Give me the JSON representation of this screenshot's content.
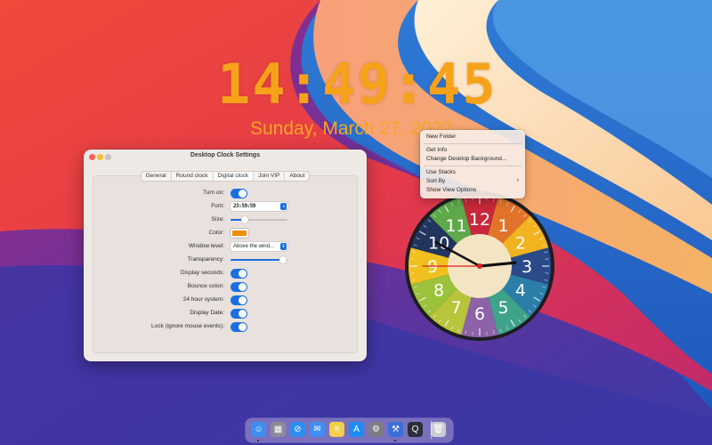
{
  "desktop_clock": {
    "time": "14:49:45",
    "date": "Sunday, March 27, 2022",
    "color": "#f6a21a"
  },
  "settings_window": {
    "title": "Desktop Clock Settings",
    "tabs": [
      {
        "label": "General",
        "active": false
      },
      {
        "label": "Round clock",
        "active": false
      },
      {
        "label": "Digital clock",
        "active": true
      },
      {
        "label": "Join VIP",
        "active": false
      },
      {
        "label": "About",
        "active": false
      }
    ],
    "rows": {
      "turn_on": {
        "label": "Turn on:",
        "value": true
      },
      "font": {
        "label": "Font:",
        "value": "23:59:59"
      },
      "size": {
        "label": "Size:",
        "value_fraction": 0.25
      },
      "color": {
        "label": "Color:",
        "value": "#f08c00"
      },
      "window_level": {
        "label": "Window level:",
        "value": "Above the wind..."
      },
      "transparency": {
        "label": "Transparency:",
        "value_fraction": 0.92
      },
      "display_seconds": {
        "label": "Display seconds:",
        "value": true
      },
      "bounce_colon": {
        "label": "Bounce colon:",
        "value": true
      },
      "hour24": {
        "label": "24 hour system:",
        "value": true
      },
      "display_date": {
        "label": "Display Date:",
        "value": true
      },
      "lock": {
        "label": "Lock (ignore mouse events):",
        "value": true
      }
    }
  },
  "context_menu": {
    "new_folder": "New Folder",
    "get_info": "Get Info",
    "change_background": "Change Desktop Background...",
    "use_stacks": "Use Stacks",
    "sort_by": "Sort By",
    "show_view_options": "Show View Options"
  },
  "analog_clock": {
    "numbers": [
      "12",
      "1",
      "2",
      "3",
      "4",
      "5",
      "6",
      "7",
      "8",
      "9",
      "10",
      "11"
    ],
    "hour": 14,
    "minute": 49,
    "second": 45
  },
  "dock": {
    "apps": [
      {
        "icon": "finder-icon",
        "color": "#3d8ef0",
        "glyph": "☺"
      },
      {
        "icon": "launchpad-icon",
        "color": "#8a8a9a",
        "glyph": "▦"
      },
      {
        "icon": "safari-icon",
        "color": "#2c8ef2",
        "glyph": "⊘"
      },
      {
        "icon": "mail-icon",
        "color": "#3e8ff0",
        "glyph": "✉"
      },
      {
        "icon": "notes-icon",
        "color": "#f3d04a",
        "glyph": "≡"
      },
      {
        "icon": "app-store-icon",
        "color": "#1d8cf2",
        "glyph": "A"
      },
      {
        "icon": "system-preferences-icon",
        "color": "#7d7d86",
        "glyph": "⚙"
      },
      {
        "icon": "xcode-icon",
        "color": "#3a6fd8",
        "glyph": "⚒"
      },
      {
        "icon": "quicktime-icon",
        "color": "#2a2f3a",
        "glyph": "Q"
      },
      {
        "icon": "trash-icon",
        "color": "#c9cdd2",
        "glyph": "🗑"
      }
    ]
  }
}
